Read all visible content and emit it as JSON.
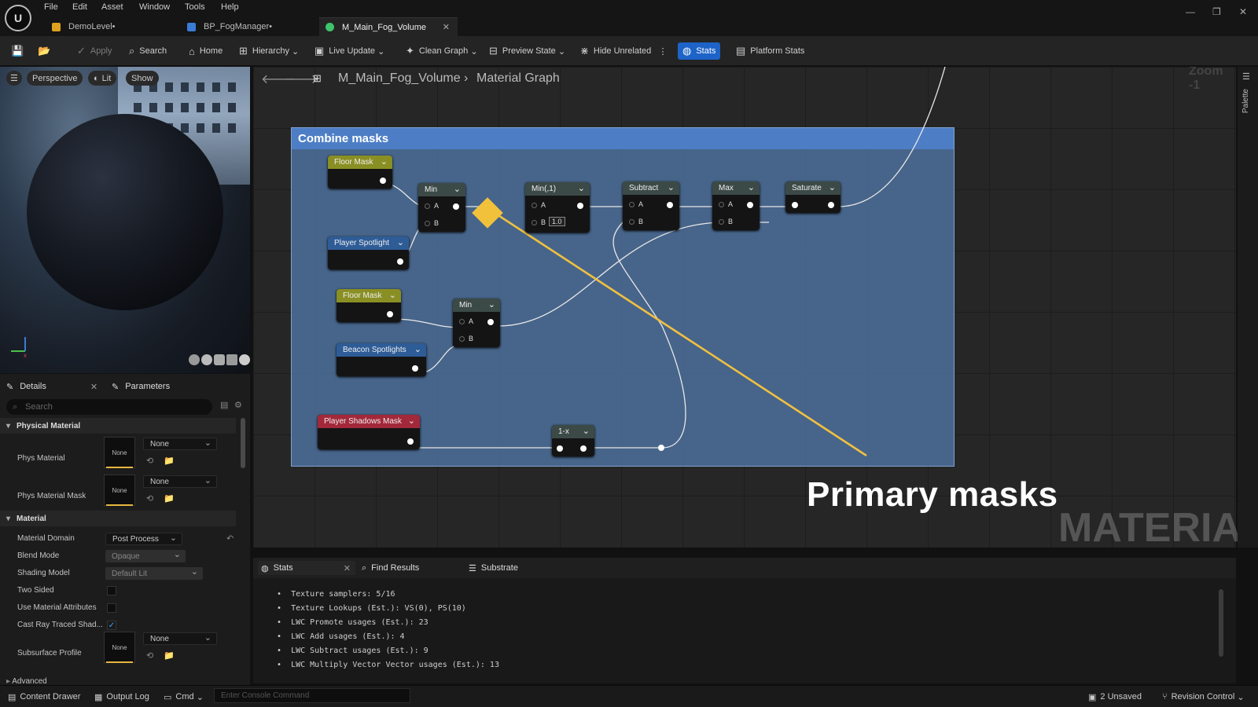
{
  "menu": [
    "File",
    "Edit",
    "Asset",
    "Window",
    "Tools",
    "Help"
  ],
  "tabs": [
    {
      "label": "DemoLevel•",
      "color": "#e0a020"
    },
    {
      "label": "BP_FogManager•",
      "color": "#3a7bd5"
    },
    {
      "label": "M_Main_Fog_Volume",
      "color": "#3ec46b"
    }
  ],
  "toolbar": {
    "apply": "Apply",
    "search": "Search",
    "home": "Home",
    "hierarchy": "Hierarchy",
    "live_update": "Live Update",
    "clean_graph": "Clean Graph",
    "preview_state": "Preview State",
    "hide_unrelated": "Hide Unrelated",
    "stats": "Stats",
    "platform_stats": "Platform Stats"
  },
  "viewport": {
    "perspective": "Perspective",
    "lit": "Lit",
    "show": "Show"
  },
  "details": {
    "tab1": "Details",
    "tab2": "Parameters",
    "search_placeholder": "Search",
    "sec_physical": "Physical Material",
    "phys_material": "Phys Material",
    "phys_material_mask": "Phys Material Mask",
    "none": "None",
    "sec_material": "Material",
    "material_domain": "Material Domain",
    "material_domain_val": "Post Process",
    "blend_mode": "Blend Mode",
    "blend_mode_val": "Opaque",
    "shading_model": "Shading Model",
    "shading_model_val": "Default Lit",
    "two_sided": "Two Sided",
    "use_attr": "Use Material Attributes",
    "cast_ray": "Cast Ray Traced Shad...",
    "subsurface": "Subsurface Profile",
    "advanced": "Advanced"
  },
  "graph": {
    "breadcrumb_asset": "M_Main_Fog_Volume",
    "breadcrumb_sub": "Material Graph",
    "zoom": "Zoom -1",
    "palette": "Palette",
    "comment": "Combine masks",
    "nodes": {
      "floor1": "Floor Mask",
      "player_spot": "Player Spotlight",
      "floor2": "Floor Mask",
      "beacon": "Beacon Spotlights",
      "shadows": "Player Shadows Mask",
      "min1": "Min",
      "min2": "Min",
      "min3": "Min(,1)",
      "sub": "Subtract",
      "max": "Max",
      "sat": "Saturate",
      "oneminus": "1-x",
      "a": "A",
      "b": "B",
      "b_val": "1.0"
    }
  },
  "overlay": {
    "title": "Primary masks",
    "watermark": "MATERIAL"
  },
  "stats": {
    "tab_stats": "Stats",
    "tab_find": "Find Results",
    "tab_substrate": "Substrate",
    "lines": [
      "Texture samplers: 5/16",
      "Texture Lookups (Est.): VS(0), PS(10)",
      "LWC Promote usages (Est.): 23",
      "LWC Add usages (Est.): 4",
      "LWC Subtract usages (Est.): 9",
      "LWC Multiply Vector Vector usages (Est.): 13"
    ]
  },
  "statusbar": {
    "content_drawer": "Content Drawer",
    "output_log": "Output Log",
    "cmd": "Cmd",
    "console_placeholder": "Enter Console Command",
    "unsaved": "2 Unsaved",
    "revision": "Revision Control"
  }
}
